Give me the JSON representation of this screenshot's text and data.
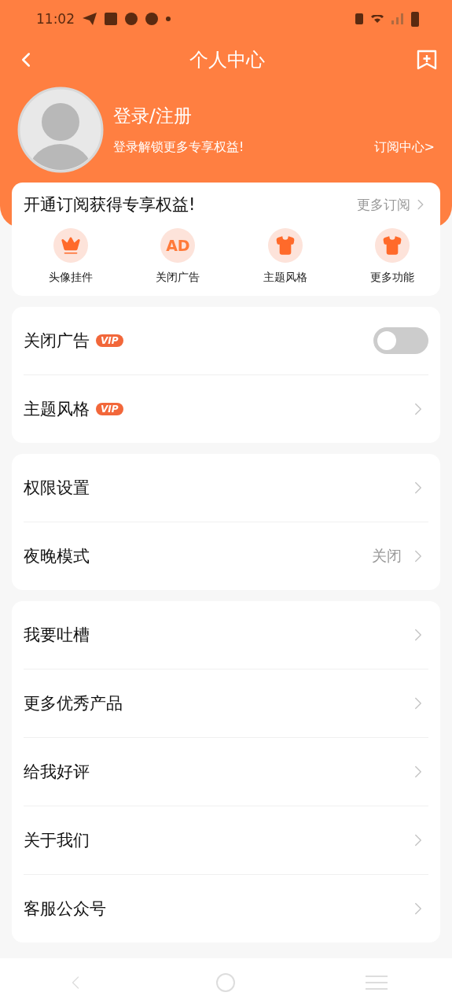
{
  "status_bar": {
    "time": "11:02"
  },
  "header": {
    "title": "个人中心"
  },
  "profile": {
    "name": "登录/注册",
    "subtitle": "登录解锁更多专享权益!",
    "link": "订阅中心>"
  },
  "subscription": {
    "title": "开通订阅获得专享权益!",
    "more": "更多订阅",
    "features": [
      {
        "label": "头像挂件",
        "kind": "crown"
      },
      {
        "label": "关闭广告",
        "kind": "ad",
        "icon_text": "AD"
      },
      {
        "label": "主题风格",
        "kind": "shirt"
      },
      {
        "label": "更多功能",
        "kind": "shirt"
      }
    ]
  },
  "groups": [
    {
      "items": [
        {
          "label": "关闭广告",
          "badge": "VIP",
          "kind": "toggle",
          "on": false
        },
        {
          "label": "主题风格",
          "badge": "VIP",
          "kind": "link"
        }
      ]
    },
    {
      "items": [
        {
          "label": "权限设置",
          "kind": "link"
        },
        {
          "label": "夜晚模式",
          "value": "关闭",
          "kind": "link"
        }
      ]
    },
    {
      "items": [
        {
          "label": "我要吐槽",
          "kind": "link"
        },
        {
          "label": "更多优秀产品",
          "kind": "link"
        },
        {
          "label": "给我好评",
          "kind": "link"
        },
        {
          "label": "关于我们",
          "kind": "link"
        },
        {
          "label": "客服公众号",
          "kind": "link"
        }
      ]
    }
  ]
}
